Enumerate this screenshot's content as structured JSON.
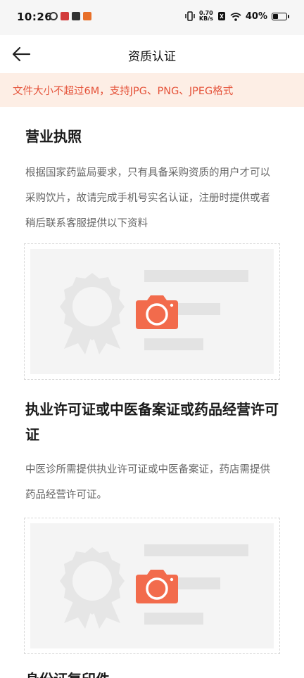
{
  "status_bar": {
    "time": "10:26",
    "net_speed_value": "0.70",
    "net_speed_unit": "KB/s",
    "battery": "40%",
    "battery_level": 0.4
  },
  "header": {
    "title": "资质认证"
  },
  "notice": {
    "text": "文件大小不超过6M，支持JPG、PNG、JPEG格式"
  },
  "sections": [
    {
      "title": "营业执照",
      "description": "根据国家药监局要求，只有具备采购资质的用户才可以采购饮片，故请完成手机号实名认证，注册时提供或者稍后联系客服提供以下资料"
    },
    {
      "title": "执业许可证或中医备案证或药品经营许可证",
      "description": "中医诊所需提供执业许可证或中医备案证，药店需提供药品经营许可证。"
    },
    {
      "title": "身份证复印件"
    }
  ],
  "colors": {
    "accent": "#f26b4c",
    "notice_bg": "#fdeee5",
    "notice_text": "#e5533a"
  }
}
